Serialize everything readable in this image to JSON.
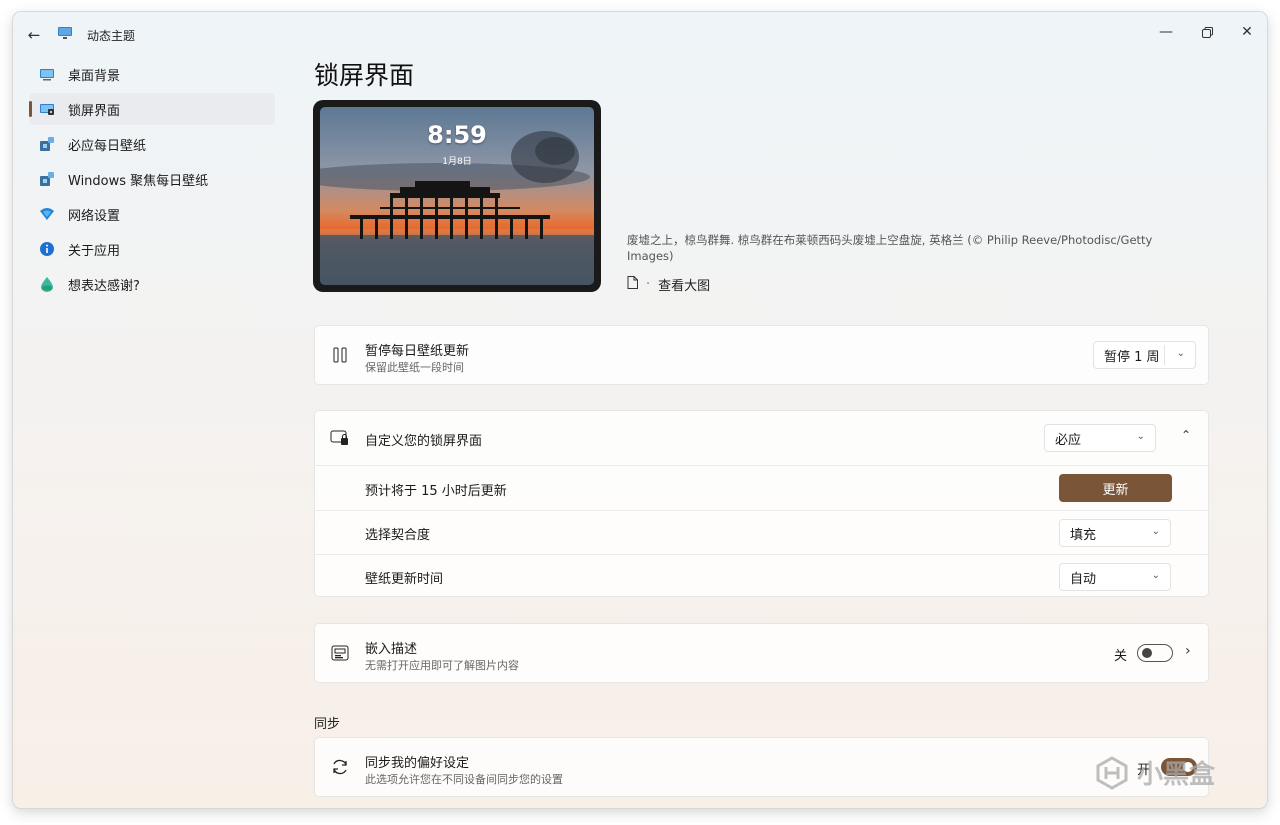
{
  "window": {
    "title": "动态主题",
    "app_icon": "monitor-app-icon"
  },
  "controls": {
    "back": "back-arrow-icon",
    "minimize": "minimize-icon",
    "maximize": "restore-icon",
    "close": "close-icon"
  },
  "sidebar": {
    "items": [
      {
        "label": "桌面背景",
        "icon": "desktop-icon",
        "active": false
      },
      {
        "label": "锁屏界面",
        "icon": "lock-screen-icon",
        "active": true
      },
      {
        "label": "必应每日壁纸",
        "icon": "puzzle-icon",
        "active": false
      },
      {
        "label": "Windows 聚焦每日壁纸",
        "icon": "puzzle-icon",
        "active": false
      },
      {
        "label": "网络设置",
        "icon": "wifi-icon",
        "active": false
      },
      {
        "label": "关于应用",
        "icon": "info-icon",
        "active": false
      },
      {
        "label": "想表达感谢?",
        "icon": "drop-icon",
        "active": false
      }
    ]
  },
  "main": {
    "title": "锁屏界面",
    "preview": {
      "time": "8:59",
      "date": "1月8日"
    },
    "caption": "废墟之上，椋鸟群舞. 椋鸟群在布莱顿西码头废墟上空盘旋, 英格兰 (© Philip Reeve/Photodisc/Getty Images)",
    "view_large": "查看大图",
    "separator": "·"
  },
  "pause_card": {
    "title": "暂停每日壁纸更新",
    "subtitle": "保留此壁纸一段时间",
    "dropdown_value": "暂停 1 周"
  },
  "customize_card": {
    "title": "自定义您的锁屏界面",
    "source_value": "必应",
    "rows": {
      "next_update": {
        "label": "预计将于 15 小时后更新",
        "button": "更新"
      },
      "fit": {
        "label": "选择契合度",
        "value": "填充"
      },
      "schedule": {
        "label": "壁纸更新时间",
        "value": "自动"
      }
    }
  },
  "embed_card": {
    "title": "嵌入描述",
    "subtitle": "无需打开应用即可了解图片内容",
    "state_label": "关",
    "state": "off"
  },
  "sync_section": {
    "label": "同步"
  },
  "sync_card": {
    "title": "同步我的偏好设定",
    "subtitle": "此选项允许您在不同设备间同步您的设置",
    "state_label": "开",
    "state": "on"
  },
  "watermark": {
    "text": "小黑盒"
  },
  "colors": {
    "accent": "#7a5538"
  }
}
